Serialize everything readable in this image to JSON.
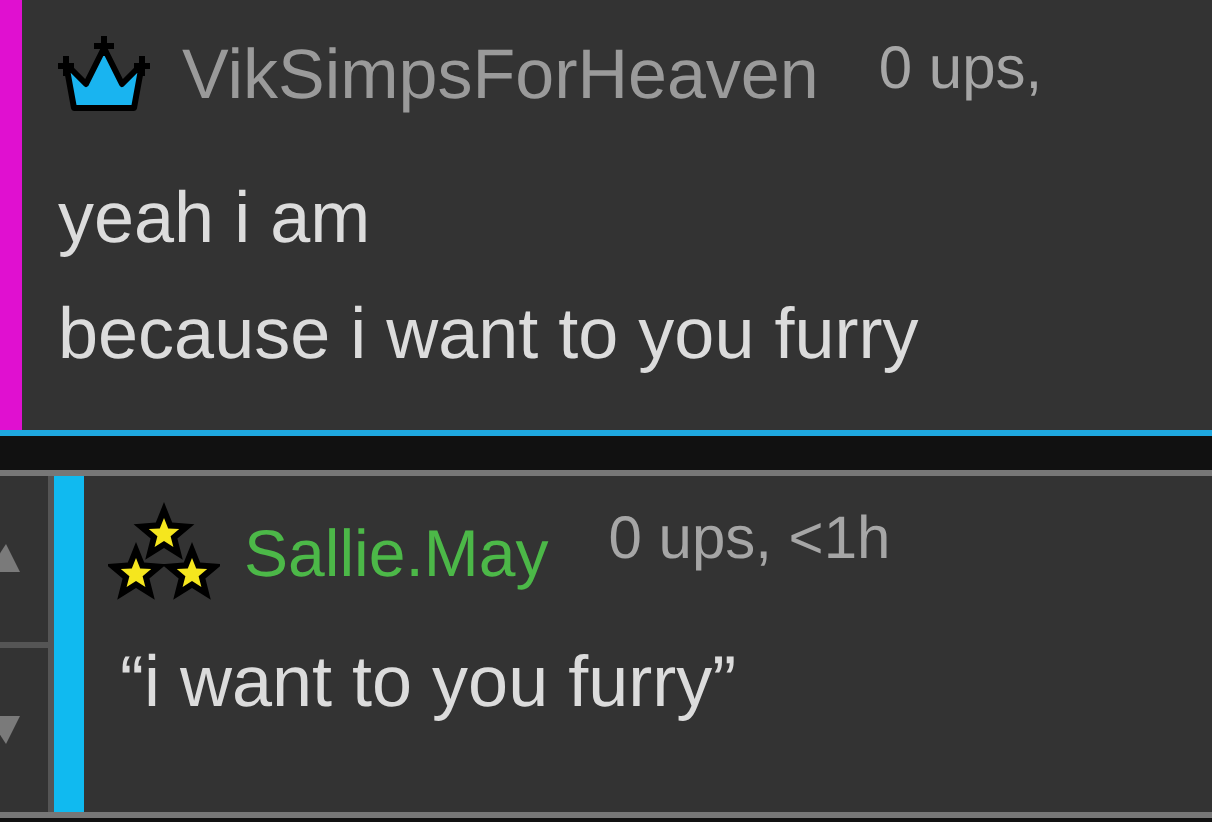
{
  "comment": {
    "username": "VikSimpsForHeaven",
    "meta": "0 ups,",
    "lines": [
      "yeah i am",
      "because i want to you furry"
    ]
  },
  "reply": {
    "username": "Sallie.May",
    "meta": "0 ups, <1h",
    "text": "“i want to you furry”"
  }
}
